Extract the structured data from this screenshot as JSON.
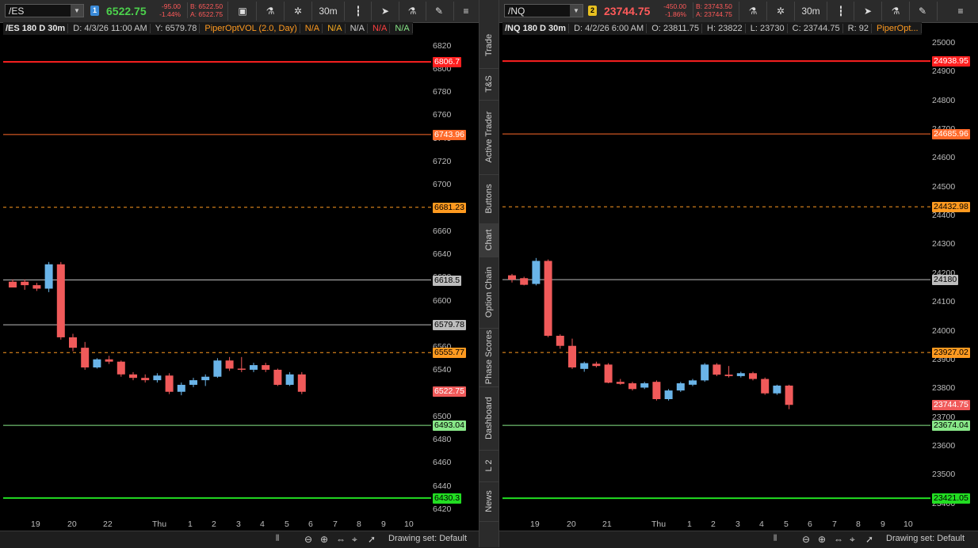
{
  "sidebar": {
    "tabs": [
      "Trade",
      "T&S",
      "Active Trader",
      "Buttons",
      "Chart",
      "Option Chain",
      "Phase Scores",
      "Dashboard",
      "L 2",
      "News"
    ],
    "active": "Chart"
  },
  "colors": {
    "up_candle": "#6ab4e8",
    "down_candle": "#f05a5a",
    "red_level": "#ff2020",
    "orange_level": "#ff6a2a",
    "dashed_level": "#ff9a20",
    "gray_level": "#bdbdbd",
    "light_green_level": "#88e888",
    "green_level": "#22dd22"
  },
  "left": {
    "symbol": "/ES",
    "link_badge": "1",
    "last_price": "6522.75",
    "net_change": "-95.00",
    "pct_change": "-1.44%",
    "bid": "B: 6522.50",
    "ask": "A: 6522.75",
    "aggregation": "30m",
    "info": {
      "title": "/ES 180 D 30m",
      "date": "D: 4/3/26 11:00 AM",
      "y": "Y: 6579.78",
      "study": "PiperOptVOL (2.0, Day)",
      "na": [
        "N/A",
        "N/A",
        "N/A",
        "N/A",
        "N/A"
      ]
    },
    "drawing_set": "Drawing set: Default",
    "chart_data": {
      "type": "candlestick",
      "y_range": [
        6420,
        6830
      ],
      "y_ticks": [
        6420,
        6440,
        6460,
        6480,
        6500,
        6520,
        6540,
        6560,
        6580,
        6600,
        6620,
        6640,
        6660,
        6680,
        6700,
        6720,
        6740,
        6760,
        6780,
        6800,
        6820
      ],
      "x_labels": [
        "19",
        "20",
        "22",
        "Thu",
        "1",
        "2",
        "3",
        "4",
        "5",
        "6",
        "7",
        "8",
        "9",
        "10"
      ],
      "levels": [
        {
          "value": 6806.7,
          "label": "6806.7",
          "style": "red_thick"
        },
        {
          "value": 6743.96,
          "label": "6743.96",
          "style": "orange"
        },
        {
          "value": 6681.23,
          "label": "6681.23",
          "style": "dashed"
        },
        {
          "value": 6618.5,
          "label": "6618.5",
          "style": "gray"
        },
        {
          "value": 6579.78,
          "label": "6579.78",
          "style": "gray"
        },
        {
          "value": 6555.77,
          "label": "6555.77",
          "style": "dashed"
        },
        {
          "value": 6493.04,
          "label": "6493.04",
          "style": "light_green"
        },
        {
          "value": 6430.3,
          "label": "6430.3",
          "style": "green_thick"
        }
      ],
      "last_tag": {
        "value": 6522.75,
        "label": "6522.75"
      },
      "candles": [
        {
          "o": 6617,
          "h": 6619,
          "l": 6612,
          "c": 6612
        },
        {
          "o": 6617,
          "h": 6619,
          "l": 6610,
          "c": 6614
        },
        {
          "o": 6614,
          "h": 6616,
          "l": 6609,
          "c": 6611
        },
        {
          "o": 6611,
          "h": 6634,
          "l": 6608,
          "c": 6632
        },
        {
          "o": 6632,
          "h": 6634,
          "l": 6567,
          "c": 6569
        },
        {
          "o": 6569,
          "h": 6572,
          "l": 6557,
          "c": 6560
        },
        {
          "o": 6560,
          "h": 6565,
          "l": 6541,
          "c": 6543
        },
        {
          "o": 6543,
          "h": 6551,
          "l": 6542,
          "c": 6550
        },
        {
          "o": 6550,
          "h": 6553,
          "l": 6546,
          "c": 6548
        },
        {
          "o": 6548,
          "h": 6549,
          "l": 6535,
          "c": 6537
        },
        {
          "o": 6537,
          "h": 6539,
          "l": 6532,
          "c": 6534
        },
        {
          "o": 6534,
          "h": 6537,
          "l": 6530,
          "c": 6532
        },
        {
          "o": 6532,
          "h": 6538,
          "l": 6530,
          "c": 6536
        },
        {
          "o": 6536,
          "h": 6538,
          "l": 6520,
          "c": 6522
        },
        {
          "o": 6522,
          "h": 6530,
          "l": 6519,
          "c": 6528
        },
        {
          "o": 6528,
          "h": 6534,
          "l": 6526,
          "c": 6532
        },
        {
          "o": 6532,
          "h": 6537,
          "l": 6527,
          "c": 6535
        },
        {
          "o": 6535,
          "h": 6551,
          "l": 6534,
          "c": 6549
        },
        {
          "o": 6549,
          "h": 6552,
          "l": 6540,
          "c": 6542
        },
        {
          "o": 6542,
          "h": 6552,
          "l": 6539,
          "c": 6541
        },
        {
          "o": 6541,
          "h": 6547,
          "l": 6539,
          "c": 6545
        },
        {
          "o": 6545,
          "h": 6547,
          "l": 6539,
          "c": 6541
        },
        {
          "o": 6541,
          "h": 6542,
          "l": 6527,
          "c": 6528
        },
        {
          "o": 6528,
          "h": 6539,
          "l": 6527,
          "c": 6537
        },
        {
          "o": 6537,
          "h": 6539,
          "l": 6520,
          "c": 6522
        }
      ]
    }
  },
  "right": {
    "symbol": "/NQ",
    "link_badge": "2",
    "last_price": "23744.75",
    "net_change": "-450.00",
    "pct_change": "-1.86%",
    "bid": "B: 23743.50",
    "ask": "A: 23744.75",
    "aggregation": "30m",
    "info": {
      "title": "/NQ 180 D 30m",
      "date": "D: 4/2/26 6:00 AM",
      "o": "O: 23811.75",
      "h": "H: 23822",
      "l": "L: 23730",
      "c": "C: 23744.75",
      "r": "R: 92",
      "study": "PiperOpt..."
    },
    "drawing_set": "Drawing set: Default",
    "chart_data": {
      "type": "candlestick",
      "y_range": [
        23380,
        25030
      ],
      "y_ticks": [
        23400,
        23500,
        23600,
        23700,
        23800,
        23900,
        24000,
        24100,
        24200,
        24300,
        24400,
        24500,
        24600,
        24700,
        24800,
        24900,
        25000
      ],
      "x_labels": [
        "19",
        "20",
        "21",
        "Thu",
        "1",
        "2",
        "3",
        "4",
        "5",
        "6",
        "7",
        "8",
        "9",
        "10"
      ],
      "levels": [
        {
          "value": 24938.95,
          "label": "24938.95",
          "style": "red_thick"
        },
        {
          "value": 24685.96,
          "label": "24685.96",
          "style": "orange"
        },
        {
          "value": 24432.98,
          "label": "24432.98",
          "style": "dashed"
        },
        {
          "value": 24180,
          "label": "24180",
          "style": "gray"
        },
        {
          "value": 23927.02,
          "label": "23927.02",
          "style": "dashed"
        },
        {
          "value": 23674.04,
          "label": "23674.04",
          "style": "light_green"
        },
        {
          "value": 23421.05,
          "label": "23421.05",
          "style": "green_thick"
        }
      ],
      "last_tag": {
        "value": 23744.75,
        "label": "23744.75"
      },
      "candles": [
        {
          "o": 24195,
          "h": 24200,
          "l": 24170,
          "c": 24180
        },
        {
          "o": 24185,
          "h": 24190,
          "l": 24160,
          "c": 24162
        },
        {
          "o": 24165,
          "h": 24255,
          "l": 24160,
          "c": 24245
        },
        {
          "o": 24245,
          "h": 24250,
          "l": 23980,
          "c": 23985
        },
        {
          "o": 23985,
          "h": 23990,
          "l": 23940,
          "c": 23950
        },
        {
          "o": 23950,
          "h": 23975,
          "l": 23870,
          "c": 23875
        },
        {
          "o": 23870,
          "h": 23895,
          "l": 23860,
          "c": 23890
        },
        {
          "o": 23888,
          "h": 23895,
          "l": 23875,
          "c": 23880
        },
        {
          "o": 23885,
          "h": 23890,
          "l": 23820,
          "c": 23822
        },
        {
          "o": 23825,
          "h": 23835,
          "l": 23815,
          "c": 23818
        },
        {
          "o": 23820,
          "h": 23825,
          "l": 23795,
          "c": 23800
        },
        {
          "o": 23805,
          "h": 23825,
          "l": 23800,
          "c": 23820
        },
        {
          "o": 23825,
          "h": 23830,
          "l": 23760,
          "c": 23765
        },
        {
          "o": 23765,
          "h": 23800,
          "l": 23760,
          "c": 23795
        },
        {
          "o": 23795,
          "h": 23825,
          "l": 23790,
          "c": 23820
        },
        {
          "o": 23815,
          "h": 23835,
          "l": 23810,
          "c": 23830
        },
        {
          "o": 23830,
          "h": 23890,
          "l": 23825,
          "c": 23885
        },
        {
          "o": 23885,
          "h": 23890,
          "l": 23845,
          "c": 23850
        },
        {
          "o": 23850,
          "h": 23880,
          "l": 23840,
          "c": 23845
        },
        {
          "o": 23845,
          "h": 23860,
          "l": 23840,
          "c": 23855
        },
        {
          "o": 23855,
          "h": 23860,
          "l": 23830,
          "c": 23835
        },
        {
          "o": 23835,
          "h": 23840,
          "l": 23780,
          "c": 23785
        },
        {
          "o": 23785,
          "h": 23815,
          "l": 23780,
          "c": 23812
        },
        {
          "o": 23812,
          "h": 23815,
          "l": 23730,
          "c": 23745
        }
      ]
    }
  }
}
